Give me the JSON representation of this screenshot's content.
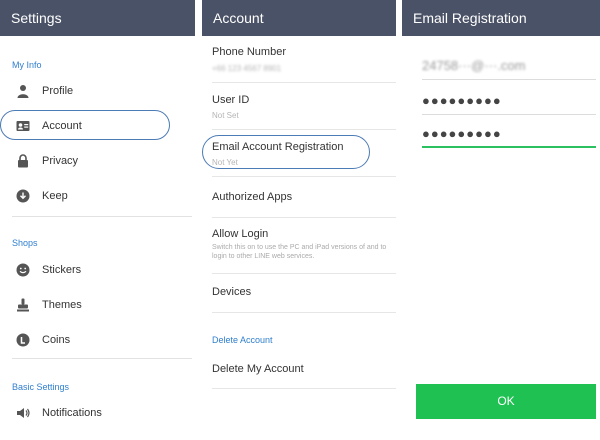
{
  "settings": {
    "title": "Settings",
    "sections": [
      {
        "label": "My Info",
        "items": [
          {
            "label": "Profile",
            "icon": "person-icon"
          },
          {
            "label": "Account",
            "icon": "id-card-icon"
          },
          {
            "label": "Privacy",
            "icon": "lock-icon"
          },
          {
            "label": "Keep",
            "icon": "download-icon"
          }
        ]
      },
      {
        "label": "Shops",
        "items": [
          {
            "label": "Stickers",
            "icon": "smiley-icon"
          },
          {
            "label": "Themes",
            "icon": "stamp-icon"
          },
          {
            "label": "Coins",
            "icon": "coin-icon"
          }
        ]
      },
      {
        "label": "Basic Settings",
        "items": [
          {
            "label": "Notifications",
            "icon": "speaker-icon"
          }
        ]
      }
    ]
  },
  "account": {
    "title": "Account",
    "phone_label": "Phone Number",
    "phone_value": "+66 123 4567 8901",
    "user_id_label": "User ID",
    "user_id_value": "Not Set",
    "email_label": "Email Account Registration",
    "email_value": "Not Yet",
    "authorized_apps": "Authorized Apps",
    "allow_login_label": "Allow Login",
    "allow_login_desc": "Switch this on to use the PC and iPad versions of and to login to other LINE web services.",
    "devices": "Devices",
    "delete_section": "Delete Account",
    "delete_my_account": "Delete My Account"
  },
  "email_registration": {
    "title": "Email Registration",
    "email_value": "24758···@···.com",
    "password": "●●●●●●●●●",
    "password_confirm": "●●●●●●●●●",
    "ok_label": "OK"
  },
  "colors": {
    "header": "#4a5267",
    "accent_blue": "#2f7fcf",
    "callout": "#4d7bb5",
    "ok_green": "#1fc252"
  }
}
